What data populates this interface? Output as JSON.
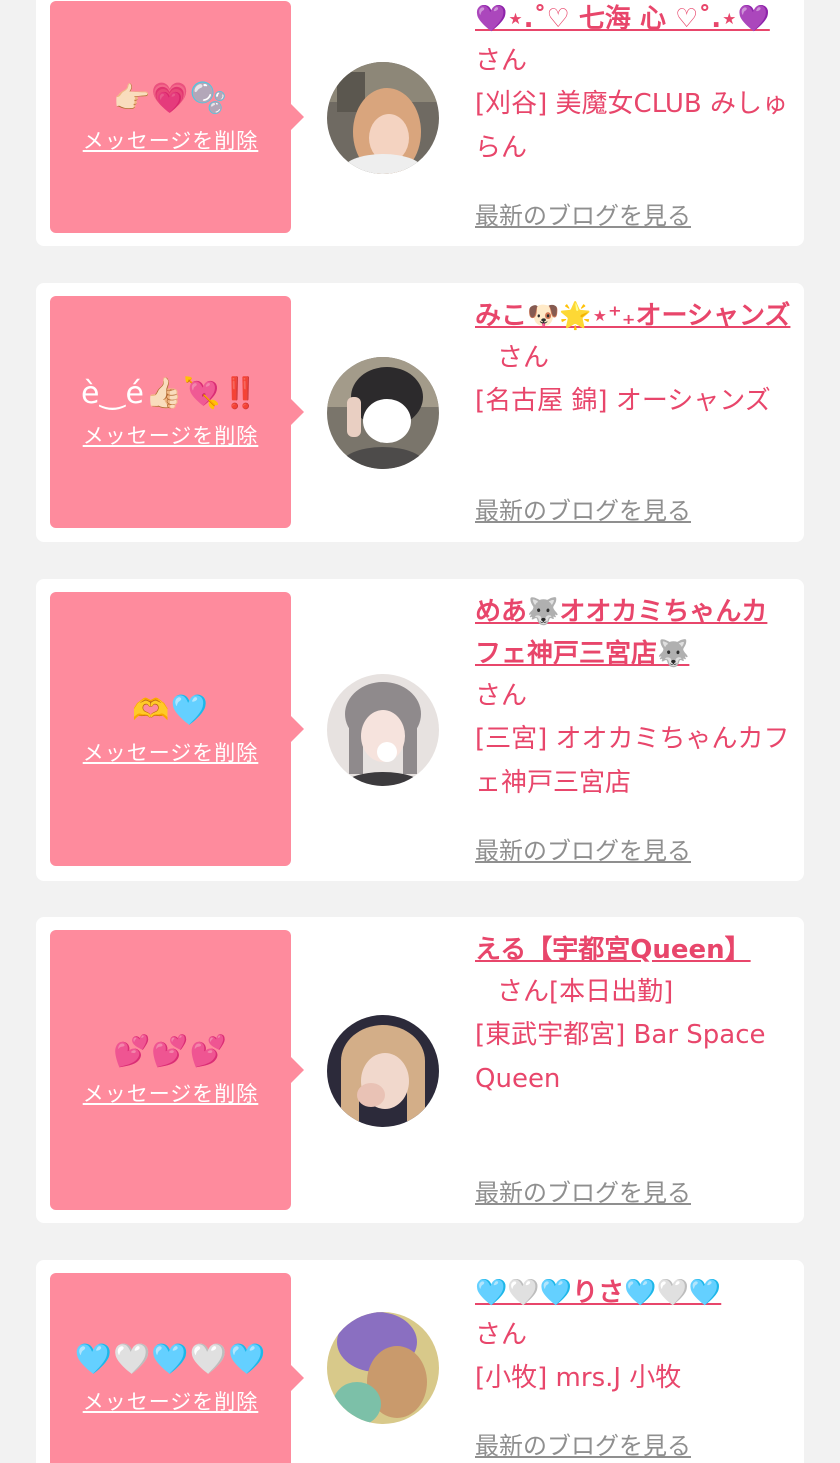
{
  "cards": [
    {
      "bubble_message": "👉🏻💗🫧",
      "delete_label": "メッセージを削除",
      "avatar_name": "avatar-photo-blonde-woman",
      "display_name": "💜⋆.˚♡ 七海 心 ♡˚.⋆💜",
      "honorific": "さん",
      "shop": "[刈谷] 美魔女CLUB みしゅらん",
      "blog_link": "最新のブログを見る"
    },
    {
      "bubble_message": "è‿é👍🏻💘‼️",
      "delete_label": "メッセージを削除",
      "avatar_name": "avatar-photo-peace-sign",
      "display_name": "みこ🐶🌟⋆⁺₊オーシャンズ",
      "honorific": "さん",
      "shop": "[名古屋 錦] オーシャンズ",
      "blog_link": "最新のブログを見る"
    },
    {
      "bubble_message": "🫶🩵",
      "delete_label": "メッセージを削除",
      "avatar_name": "avatar-photo-wolf-cafe-girl",
      "display_name": "めあ🐺オオカミちゃんカフェ神戸三宮店🐺",
      "honorific": "さん",
      "shop": "[三宮] オオカミちゃんカフェ神戸三宮店",
      "blog_link": "最新のブログを見る"
    },
    {
      "bubble_message": "💕💕💕",
      "delete_label": "メッセージを削除",
      "avatar_name": "avatar-photo-blonde-hand-face",
      "display_name": "える【宇都宮Queen】",
      "honorific": "さん[本日出勤]",
      "shop": "[東武宇都宮] Bar Space Queen",
      "blog_link": "最新のブログを見る"
    },
    {
      "bubble_message": "🩵🤍🩵🤍🩵",
      "delete_label": "メッセージを削除",
      "avatar_name": "avatar-photo-purple-sticker",
      "display_name": "🩵🤍🩵りさ🩵🤍🩵",
      "honorific": "さん",
      "shop": "[小牧] mrs.J 小牧",
      "blog_link": "最新のブログを見る"
    }
  ],
  "colors": {
    "background": "#f2f2f2",
    "card": "#ffffff",
    "bubble": "#fe8b9d",
    "accent": "#e8466b",
    "link_gray": "#8f8f8f"
  }
}
